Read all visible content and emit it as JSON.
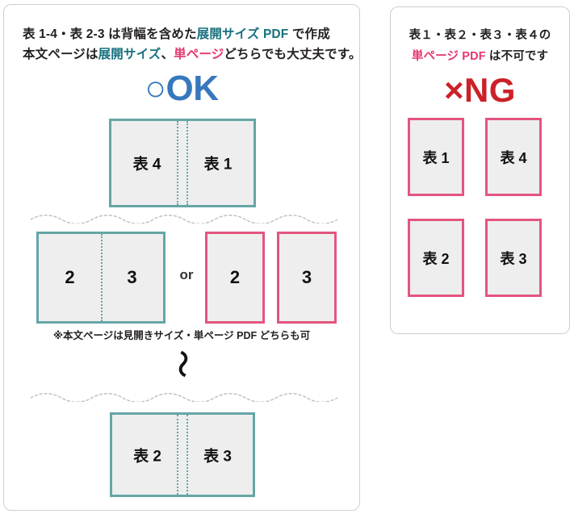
{
  "ok_panel": {
    "heading_line1_prefix": "表 1-4・表 2-3 は背幅を含めた",
    "heading_line1_accent": "展開サイズ PDF",
    "heading_line1_suffix": " で作成",
    "heading_line2_prefix": "本文ページは",
    "heading_line2_accent1": "展開サイズ",
    "heading_line2_middle": "、",
    "heading_line2_accent2": "単ページ",
    "heading_line2_suffix": "どちらでも大丈夫です。",
    "verdict_mark": "○",
    "verdict_label": "OK",
    "cover_spread_front": {
      "left_page": "表 4",
      "right_page": "表 1"
    },
    "body_spread": {
      "left_page": "2",
      "right_page": "3"
    },
    "or_label": "or",
    "body_single_pages": [
      "2",
      "3"
    ],
    "body_note": "※本文ページは見開きサイズ・単ページ PDF どちらも可",
    "continuation_mark": "〜",
    "cover_spread_back": {
      "left_page": "表 2",
      "right_page": "表 3"
    }
  },
  "ng_panel": {
    "heading_line1": "表１・表２・表３・表４の",
    "heading_line2_accent": "単ページ PDF",
    "heading_line2_suffix": " は不可です",
    "verdict_mark": "×",
    "verdict_label": "NG",
    "pages": [
      "表 1",
      "表 4",
      "表 2",
      "表 3"
    ]
  },
  "colors": {
    "teal_border": "#65a6a6",
    "pink_border": "#e4557f",
    "teal_text": "#17707e",
    "pink_text": "#e7376c",
    "ok_blue": "#3778bd",
    "ng_red": "#cc2128",
    "page_fill": "#eeeeee",
    "panel_border": "#cfcfcf"
  }
}
